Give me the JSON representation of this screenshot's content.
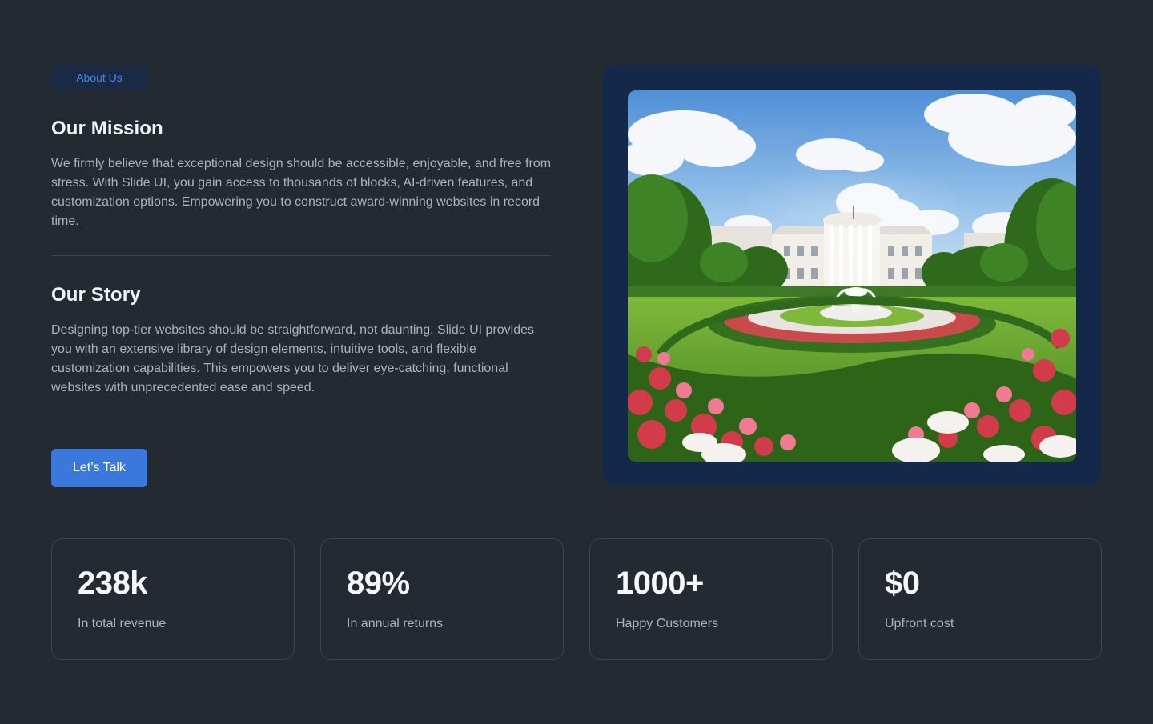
{
  "about": {
    "badge_label": "About Us",
    "mission_heading": "Our Mission",
    "mission_text": "We firmly believe that exceptional design should be accessible, enjoyable, and free from stress. With Slide UI, you gain access to thousands of blocks, AI-driven features, and customization options. Empowering you to construct award-winning websites in record time.",
    "story_heading": "Our Story",
    "story_text": "Designing top-tier websites should be straightforward, not daunting. Slide UI provides you with an extensive library of design elements, intuitive tools, and flexible customization capabilities. This empowers you to deliver eye-catching, functional websites with unprecedented ease and speed.",
    "cta_label": "Let’s Talk"
  },
  "stats": [
    {
      "value": "238k",
      "label": "In total revenue"
    },
    {
      "value": "89%",
      "label": "In annual returns"
    },
    {
      "value": "1000+",
      "label": "Happy Customers"
    },
    {
      "value": "$0",
      "label": "Upfront cost"
    }
  ],
  "colors": {
    "background": "#232a32",
    "accent": "#3a78db",
    "badge_text": "#3f86f0",
    "image_frame": "#14294a"
  }
}
